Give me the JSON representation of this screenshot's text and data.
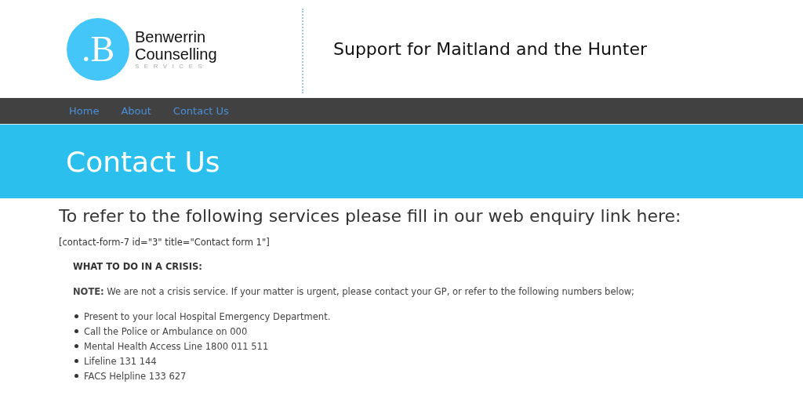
{
  "header": {
    "logo": {
      "mark": ".B",
      "name_line_1": "Benwerrin",
      "name_line_2": "Counselling",
      "name_line_3": "SERVICES"
    },
    "tagline": "Support for Maitland and the Hunter"
  },
  "nav": {
    "items": [
      {
        "label": "Home"
      },
      {
        "label": "About"
      },
      {
        "label": "Contact Us"
      }
    ]
  },
  "banner": {
    "title": "Contact Us"
  },
  "content": {
    "heading": "To refer to the following services please fill in our web enquiry link here:",
    "shortcode": "[contact-form-7 id=\"3\" title=\"Contact form 1\"]",
    "crisis_heading": "WHAT TO DO IN A CRISIS:",
    "note": "**NOTE:** We are not a crisis service. If your matter is urgent, please contact your GP, or refer to the following numbers below;",
    "list": [
      "Present to your local Hospital Emergency Department.",
      "Call the Police or Ambulance on 000",
      "Mental Health Access Line 1800 011 511",
      "Lifeline 131 144",
      "FACS Helpline 133 627"
    ]
  }
}
